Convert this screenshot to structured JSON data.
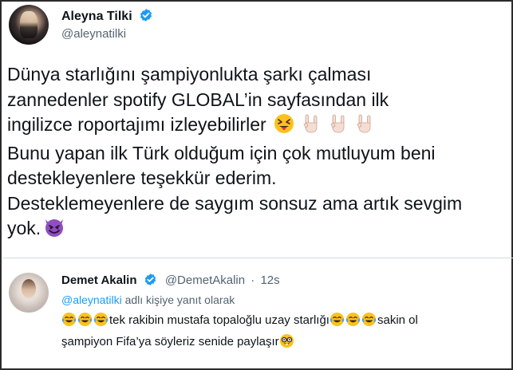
{
  "main_tweet": {
    "author_name": "Aleyna Tilki",
    "author_handle": "@aleynatilki",
    "lines": [
      "Dünya starlığını şampiyonlukta şarkı çalması",
      "zannedenler spotify GLOBAL’in  sayfasından ilk",
      "ingilizce roportajımı izleyebilirler",
      "Bunu yapan ilk Türk olduğum için çok mutluyum beni",
      "destekleyenlere teşekkür ederim.",
      "Desteklemeyenlere de saygım sonsuz ama artık sevgim",
      "yok."
    ],
    "icons": [
      "verified-badge-icon",
      "squinting-tongue-emoji",
      "rock-on-hand-emoji",
      "smiling-devil-emoji"
    ]
  },
  "reply_tweet": {
    "author_name": "Demet Akalin",
    "author_handle": "@DemetAkalin",
    "separator": "·",
    "time": "12s",
    "reply_mention": "@aleynatilki",
    "reply_suffix": " adlı kişiye yanıt olarak",
    "line1_text_a": "tek rakibin mustafa topaloğlu uzay starlığı",
    "line1_text_b": "sakin ol",
    "line2_text": "şampiyon Fifa’ya söyleriz senide paylaşır",
    "icons": [
      "verified-badge-icon",
      "tears-of-joy-emoji",
      "nerd-face-emoji"
    ]
  },
  "colors": {
    "text": "#0f1419",
    "secondary": "#536471",
    "link": "#1d9bf0",
    "verified": "#1d9bf0",
    "divider": "#cfd9de"
  }
}
